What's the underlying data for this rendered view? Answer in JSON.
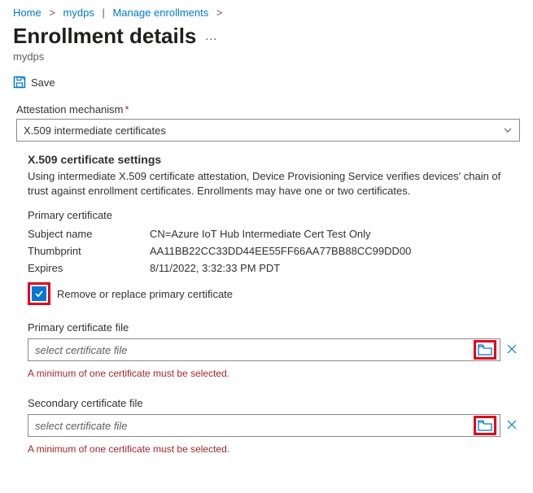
{
  "breadcrumb": {
    "home": "Home",
    "dps": "mydps",
    "manage": "Manage enrollments"
  },
  "page": {
    "title": "Enrollment details",
    "more": "…",
    "subtitle": "mydps"
  },
  "toolbar": {
    "save_label": "Save"
  },
  "form": {
    "attestation_label": "Attestation mechanism",
    "attestation_value": "X.509 intermediate certificates",
    "x509_heading": "X.509 certificate settings",
    "x509_desc": "Using intermediate X.509 certificate attestation, Device Provisioning Service verifies devices' chain of trust against enrollment certificates. Enrollments may have one or two certificates.",
    "primary_cert_label": "Primary certificate",
    "rows": {
      "subject_label": "Subject name",
      "subject_value": "CN=Azure IoT Hub Intermediate Cert Test Only",
      "thumbprint_label": "Thumbprint",
      "thumbprint_value": "AA11BB22CC33DD44EE55FF66AA77BB88CC99DD00",
      "expires_label": "Expires",
      "expires_value": "8/11/2022, 3:32:33 PM PDT"
    },
    "remove_replace_label": "Remove or replace primary certificate",
    "primary_file_label": "Primary certificate file",
    "primary_file_placeholder": "select certificate file",
    "primary_file_error": "A minimum of one certificate must be selected.",
    "secondary_file_label": "Secondary certificate file",
    "secondary_file_placeholder": "select certificate file",
    "secondary_file_error": "A minimum of one certificate must be selected."
  }
}
